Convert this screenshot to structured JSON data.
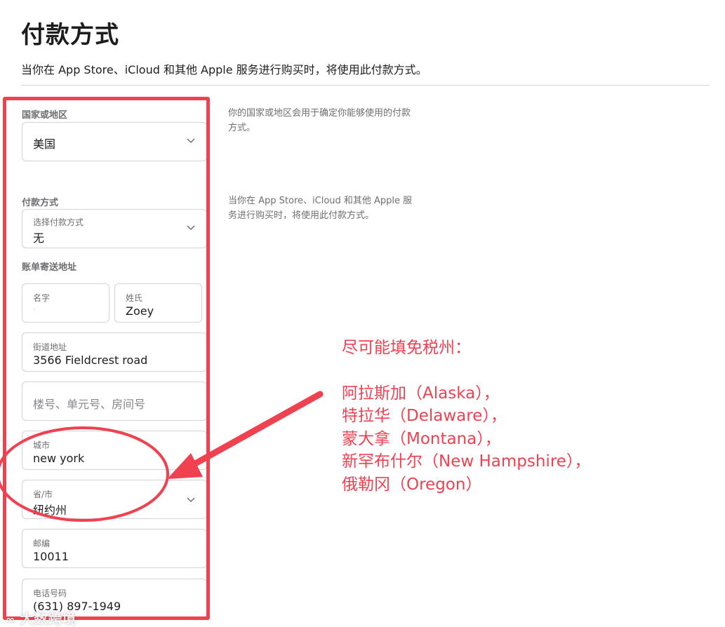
{
  "page": {
    "title": "付款方式",
    "subtitle": "当你在 App Store、iCloud 和其他 Apple 服务进行购买时，将使用此付款方式。"
  },
  "country": {
    "section_label": "国家或地区",
    "value": "美国",
    "hint": "你的国家或地区会用于确定你能够使用的付款方式。"
  },
  "payment": {
    "section_label": "付款方式",
    "field_label": "选择付款方式",
    "value": "无",
    "hint": "当你在 App Store、iCloud 和其他 Apple 服务进行购买时，将使用此付款方式。"
  },
  "billing": {
    "section_label": "账单寄送地址",
    "first_name": {
      "label": "名字",
      "value": "."
    },
    "last_name": {
      "label": "姓氏",
      "value": "Zoey"
    },
    "street": {
      "label": "街道地址",
      "value": "3566 Fieldcrest road"
    },
    "unit": {
      "placeholder": "楼号、单元号、房间号"
    },
    "city": {
      "label": "城市",
      "value": "new york"
    },
    "state": {
      "label": "省/市",
      "value": "纽约州"
    },
    "zip": {
      "label": "邮编",
      "value": "10011"
    },
    "phone": {
      "label": "电话号码",
      "value": "(631) 897-1949"
    }
  },
  "annotation": {
    "heading": "尽可能填免税州：",
    "states": [
      "阿拉斯加（Alaska），",
      "特拉华（Delaware），",
      "蒙大拿（Montana），",
      "新罕布什尔（New Hampshire），",
      "俄勒冈（Oregon）"
    ],
    "color": "#ef4150"
  },
  "watermark": {
    "text": "大数跨境"
  },
  "icons": {
    "chevron": "chevron-down-icon"
  }
}
